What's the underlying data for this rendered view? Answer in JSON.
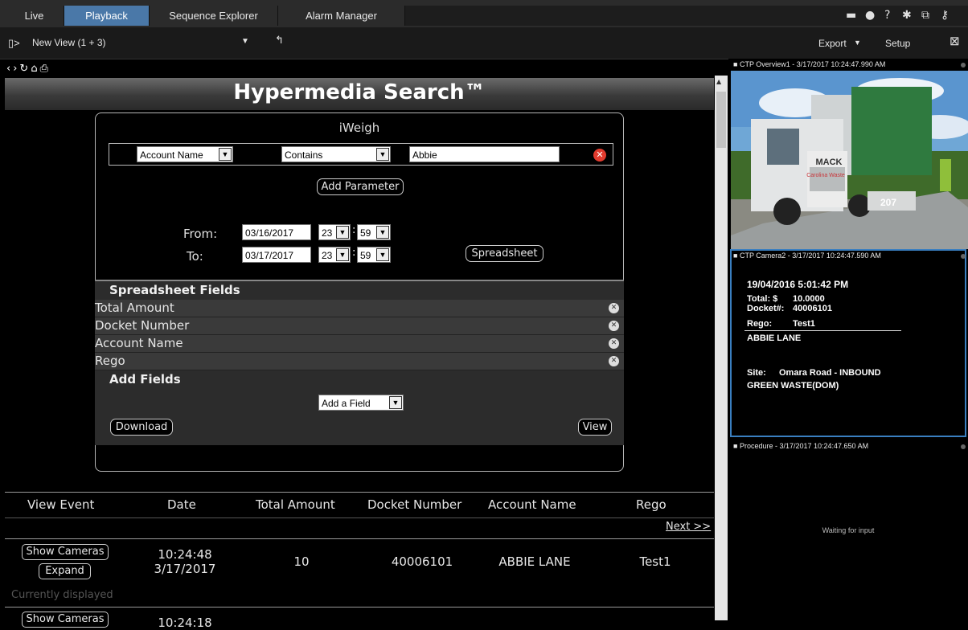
{
  "tabs": [
    {
      "label": "Live",
      "active": false
    },
    {
      "label": "Playback",
      "active": true
    },
    {
      "label": "Sequence Explorer",
      "active": false
    },
    {
      "label": "Alarm Manager",
      "active": false
    }
  ],
  "toolbar": {
    "view_name": "New View (1 + 3)",
    "export_label": "Export",
    "setup_label": "Setup"
  },
  "search": {
    "title": "Hypermedia Search™",
    "panel_title": "iWeigh",
    "param_field": "Account Name",
    "param_operator": "Contains",
    "param_value": "Abbie",
    "add_parameter_label": "Add Parameter",
    "from_label": "From:",
    "to_label": "To:",
    "from_date": "03/16/2017",
    "from_hour": "23",
    "from_minute": "59",
    "to_date": "03/17/2017",
    "to_hour": "23",
    "to_minute": "59",
    "spreadsheet_label": "Spreadsheet",
    "spreadsheet_fields_heading": "Spreadsheet Fields",
    "spreadsheet_fields": [
      "Total Amount",
      "Docket Number",
      "Account Name",
      "Rego"
    ],
    "add_fields_heading": "Add Fields",
    "add_field_select": "Add a Field",
    "download_label": "Download",
    "view_label": "View"
  },
  "results": {
    "columns": [
      "View Event",
      "Date",
      "Total Amount",
      "Docket Number",
      "Account Name",
      "Rego"
    ],
    "next_label": "Next >>",
    "rows": [
      {
        "show_cameras": "Show Cameras",
        "expand": "Expand",
        "time": "10:24:48",
        "date": "3/17/2017",
        "total": "10",
        "docket": "40006101",
        "account": "ABBIE LANE",
        "rego": "Test1",
        "status": "Currently displayed"
      },
      {
        "show_cameras": "Show Cameras",
        "time": "10:24:18"
      }
    ]
  },
  "cameras": [
    {
      "title": "CTP Overview1 - 3/17/2017 10:24:47.990 AM"
    },
    {
      "title": "CTP Camera2 - 3/17/2017 10:24:47.590 AM",
      "receipt": {
        "timestamp": "19/04/2016 5:01:42 PM",
        "total_label": "Total: $",
        "total_value": "10.0000",
        "docket_label": "Docket#:",
        "docket_value": "40006101",
        "rego_label": "Rego:",
        "rego_value": "Test1",
        "account": "ABBIE LANE",
        "site_label": "Site:",
        "site_value": "Omara Road - INBOUND",
        "material": "GREEN WASTE(DOM)"
      }
    },
    {
      "title": "Procedure - 3/17/2017 10:24:47.650 AM",
      "status": "Waiting for input"
    }
  ],
  "truck_text": {
    "brand": "MACK",
    "decal": "Carolina Waste",
    "number": "207"
  },
  "colors": {
    "active_tab": "#4a78a8",
    "remove": "#e23b2e",
    "selected_pane": "#3a7fc0"
  }
}
